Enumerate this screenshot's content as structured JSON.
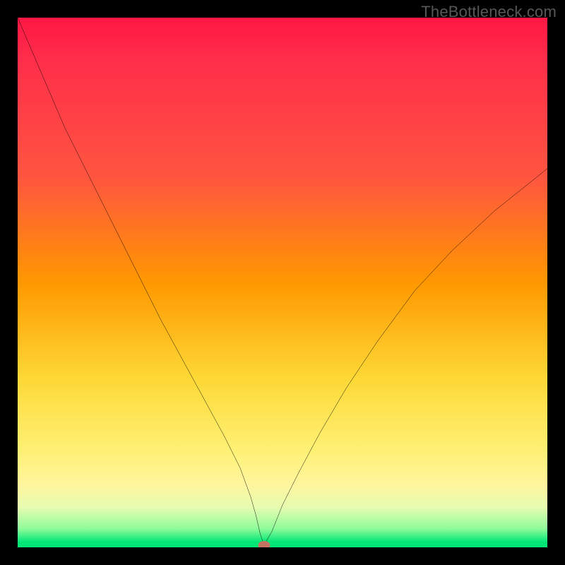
{
  "watermark": "TheBottleneck.com",
  "chart_data": {
    "type": "line",
    "title": "",
    "xlabel": "",
    "ylabel": "",
    "xlim": [
      0,
      100
    ],
    "ylim": [
      0,
      100
    ],
    "grid": false,
    "series": [
      {
        "name": "bottleneck-curve",
        "x": [
          0,
          3,
          6,
          9,
          12,
          15,
          18,
          21,
          24,
          27,
          30,
          33,
          36,
          39,
          42,
          44,
          45,
          45.8,
          46.5,
          48,
          50,
          53,
          57,
          62,
          68,
          75,
          82,
          90,
          100
        ],
        "y": [
          100,
          93,
          86,
          79,
          73,
          67,
          61,
          55,
          49,
          43,
          37.5,
          32,
          26.5,
          21,
          15,
          9.5,
          6,
          2.5,
          0.4,
          3,
          8,
          14,
          21.5,
          30,
          39,
          48.5,
          56,
          63.5,
          71.5
        ]
      }
    ],
    "marker": {
      "x": 46.5,
      "y": 0.4,
      "color": "#c47262"
    },
    "background_gradient": {
      "stops": [
        {
          "pos": 0,
          "color": "#ff1744"
        },
        {
          "pos": 50,
          "color": "#ff9800"
        },
        {
          "pos": 75,
          "color": "#fdd835"
        },
        {
          "pos": 92,
          "color": "#fff59d"
        },
        {
          "pos": 100,
          "color": "#00e676"
        }
      ]
    }
  },
  "marker_style": {
    "left_pct": 46.5,
    "top_pct": 99.6
  }
}
